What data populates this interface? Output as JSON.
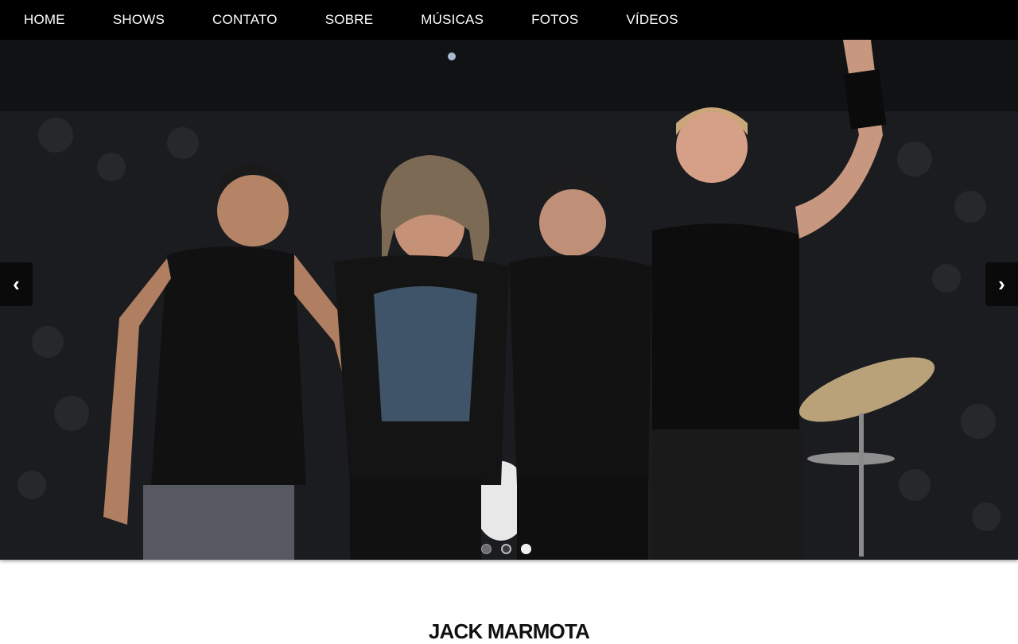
{
  "nav": {
    "items": [
      {
        "label": "HOME"
      },
      {
        "label": "SHOWS"
      },
      {
        "label": "CONTATO"
      },
      {
        "label": "SOBRE"
      },
      {
        "label": "MÚSICAS"
      },
      {
        "label": "FOTOS"
      },
      {
        "label": "VÍDEOS"
      }
    ]
  },
  "carousel": {
    "prev_icon": "‹",
    "next_icon": "›",
    "slide_count": 3,
    "active_slide": 3
  },
  "band": {
    "title": "JACK MARMOTA"
  },
  "colors": {
    "nav_bg": "#000000",
    "nav_text": "#ffffff",
    "page_bg": "#ffffff"
  }
}
